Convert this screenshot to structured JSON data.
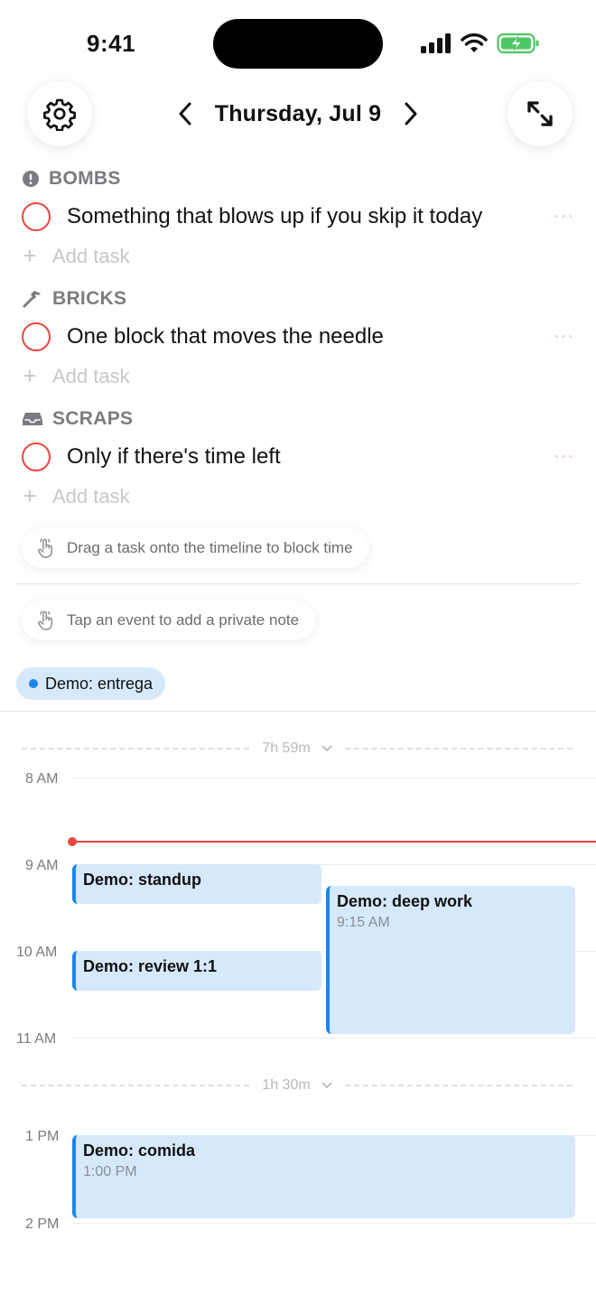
{
  "status_bar": {
    "time": "9:41"
  },
  "header": {
    "date_title": "Thursday, Jul 9",
    "settings_icon": "gear-icon",
    "prev_icon": "chevron-left-icon",
    "next_icon": "chevron-right-icon",
    "expand_icon": "expand-arrows-icon"
  },
  "sections": [
    {
      "id": "bombs",
      "title": "BOMBS",
      "icon": "exclamation-circle-icon",
      "tasks": [
        {
          "text": "Something that blows up if you skip it today",
          "more": "···"
        }
      ],
      "add_label": "Add task"
    },
    {
      "id": "bricks",
      "title": "BRICKS",
      "icon": "hammer-icon",
      "tasks": [
        {
          "text": "One block that moves the needle",
          "more": "···"
        }
      ],
      "add_label": "Add task"
    },
    {
      "id": "scraps",
      "title": "SCRAPS",
      "icon": "tray-icon",
      "tasks": [
        {
          "text": "Only if there's time left",
          "more": "···"
        }
      ],
      "add_label": "Add task"
    }
  ],
  "hints": [
    {
      "text": "Drag a task onto the timeline to block time",
      "icon": "tap-hand-icon"
    },
    {
      "text": "Tap an event to add a private note",
      "icon": "tap-hand-icon"
    }
  ],
  "all_day": {
    "label": "Demo: entrega",
    "color": "#1a85f0"
  },
  "timeline": {
    "gaps": [
      {
        "label": "7h 59m"
      },
      {
        "label": "1h 30m"
      }
    ],
    "hours": [
      "8 AM",
      "9 AM",
      "10 AM",
      "11 AM",
      "1 PM",
      "2 PM"
    ],
    "events": [
      {
        "title": "Demo: standup",
        "time": ""
      },
      {
        "title": "Demo: deep work",
        "time": "9:15 AM"
      },
      {
        "title": "Demo: review 1:1",
        "time": ""
      },
      {
        "title": "Demo: comida",
        "time": "1:00 PM"
      }
    ],
    "accent": "#1a85f0",
    "now_color": "#e8473e"
  }
}
